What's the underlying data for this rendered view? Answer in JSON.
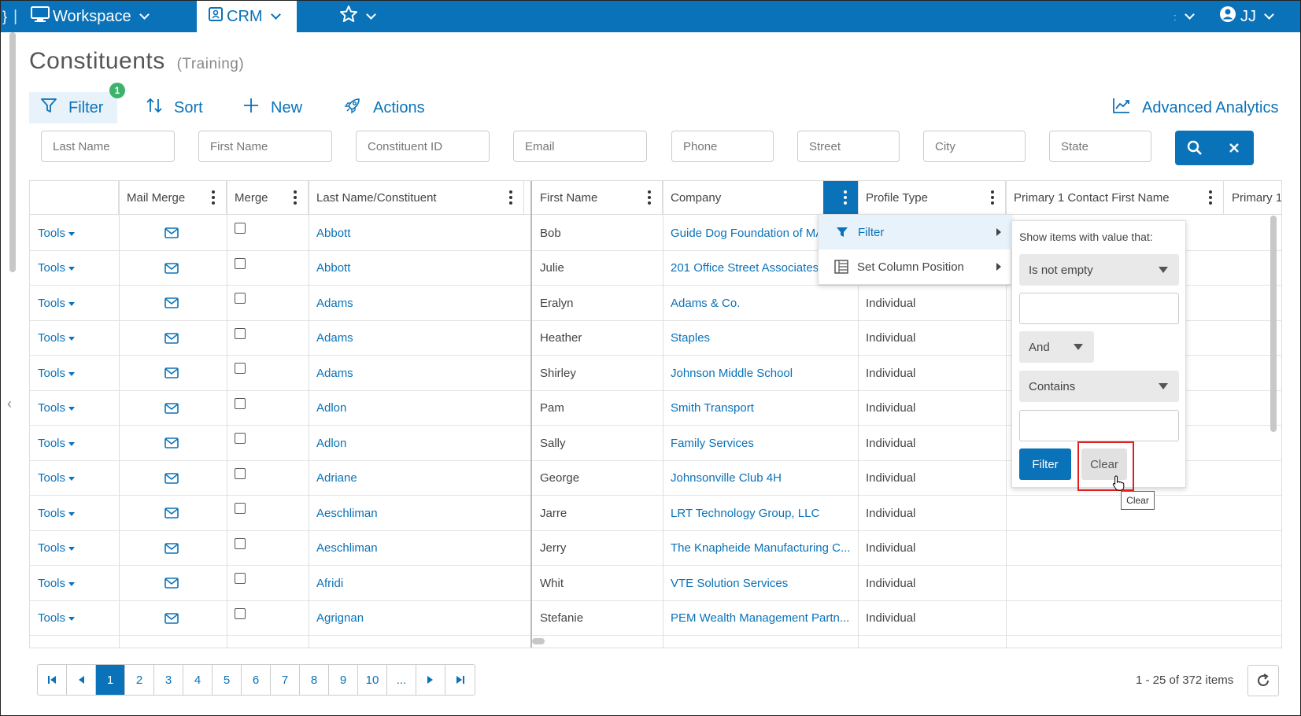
{
  "topbar": {
    "workspace_label": "Workspace",
    "crm_label": "CRM",
    "user_initials": "JJ",
    "colors": {
      "brand": "#0a72b8",
      "badge": "#3bb36b"
    }
  },
  "page": {
    "title": "Constituents",
    "subtitle": "(Training)"
  },
  "toolbar": {
    "filter_label": "Filter",
    "filter_count": "1",
    "sort_label": "Sort",
    "new_label": "New",
    "actions_label": "Actions",
    "analytics_label": "Advanced Analytics"
  },
  "search": {
    "last_name": "Last Name",
    "first_name": "First Name",
    "constituent_id": "Constituent ID",
    "email": "Email",
    "phone": "Phone",
    "street": "Street",
    "city": "City",
    "state": "State"
  },
  "grid": {
    "columns": [
      "",
      "Mail Merge",
      "Merge",
      "Last Name/Constituent",
      "First Name",
      "Company",
      "Profile Type",
      "Primary 1 Contact First Name",
      "Primary 1"
    ],
    "tools_label": "Tools",
    "rows": [
      {
        "last": "Abbott",
        "first": "Bob",
        "company": "Guide Dog Foundation of MA",
        "type": ""
      },
      {
        "last": "Abbott",
        "first": "Julie",
        "company": "201 Office Street Associates",
        "type": ""
      },
      {
        "last": "Adams",
        "first": "Eralyn",
        "company": "Adams & Co.",
        "type": "Individual"
      },
      {
        "last": "Adams",
        "first": "Heather",
        "company": "Staples",
        "type": "Individual"
      },
      {
        "last": "Adams",
        "first": "Shirley",
        "company": "Johnson Middle School",
        "type": "Individual"
      },
      {
        "last": "Adlon",
        "first": "Pam",
        "company": "Smith Transport",
        "type": "Individual"
      },
      {
        "last": "Adlon",
        "first": "Sally",
        "company": "Family Services",
        "type": "Individual"
      },
      {
        "last": "Adriane",
        "first": "George",
        "company": "Johnsonville Club 4H",
        "type": "Individual"
      },
      {
        "last": "Aeschliman",
        "first": "Jarre",
        "company": "LRT Technology Group, LLC",
        "type": "Individual"
      },
      {
        "last": "Aeschliman",
        "first": "Jerry",
        "company": "The Knapheide Manufacturing C...",
        "type": "Individual"
      },
      {
        "last": "Afridi",
        "first": "Whit",
        "company": "VTE Solution Services",
        "type": "Individual"
      },
      {
        "last": "Agrignan",
        "first": "Stefanie",
        "company": "PEM Wealth Management Partn...",
        "type": "Individual"
      }
    ]
  },
  "column_menu": {
    "filter_label": "Filter",
    "position_label": "Set Column Position"
  },
  "filter_popup": {
    "heading": "Show items with value that:",
    "operator1": "Is not empty",
    "logic": "And",
    "operator2": "Contains",
    "filter_button": "Filter",
    "clear_button": "Clear",
    "tooltip": "Clear"
  },
  "pager": {
    "pages": [
      "1",
      "2",
      "3",
      "4",
      "5",
      "6",
      "7",
      "8",
      "9",
      "10",
      "..."
    ],
    "current": "1",
    "info": "1 - 25 of 372 items"
  }
}
